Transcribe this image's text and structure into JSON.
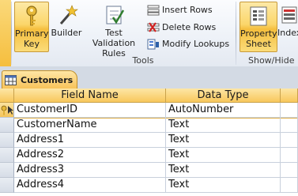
{
  "ribbon": {
    "buttons": {
      "primary_key": "Primary\nKey",
      "builder": "Builder",
      "test_validation": "Test Validation\nRules",
      "property_sheet": "Property\nSheet",
      "indexes": "Indexes"
    },
    "rows": {
      "insert": "Insert Rows",
      "delete": "Delete Rows",
      "modify_lookups": "Modify Lookups"
    },
    "groups": {
      "tools": "Tools",
      "show_hide": "Show/Hide"
    }
  },
  "tab": {
    "title": "Customers"
  },
  "grid": {
    "headers": {
      "field_name": "Field Name",
      "data_type": "Data Type"
    },
    "rows": [
      {
        "field": "CustomerID",
        "type": "AutoNumber",
        "primary_key": true
      },
      {
        "field": "CustomerName",
        "type": "Text"
      },
      {
        "field": "Address1",
        "type": "Text"
      },
      {
        "field": "Address2",
        "type": "Text"
      },
      {
        "field": "Address3",
        "type": "Text"
      },
      {
        "field": "Address4",
        "type": "Text"
      }
    ]
  },
  "colors": {
    "accent": "#f8c75c",
    "ribbon_bg": "#eef2f8"
  }
}
